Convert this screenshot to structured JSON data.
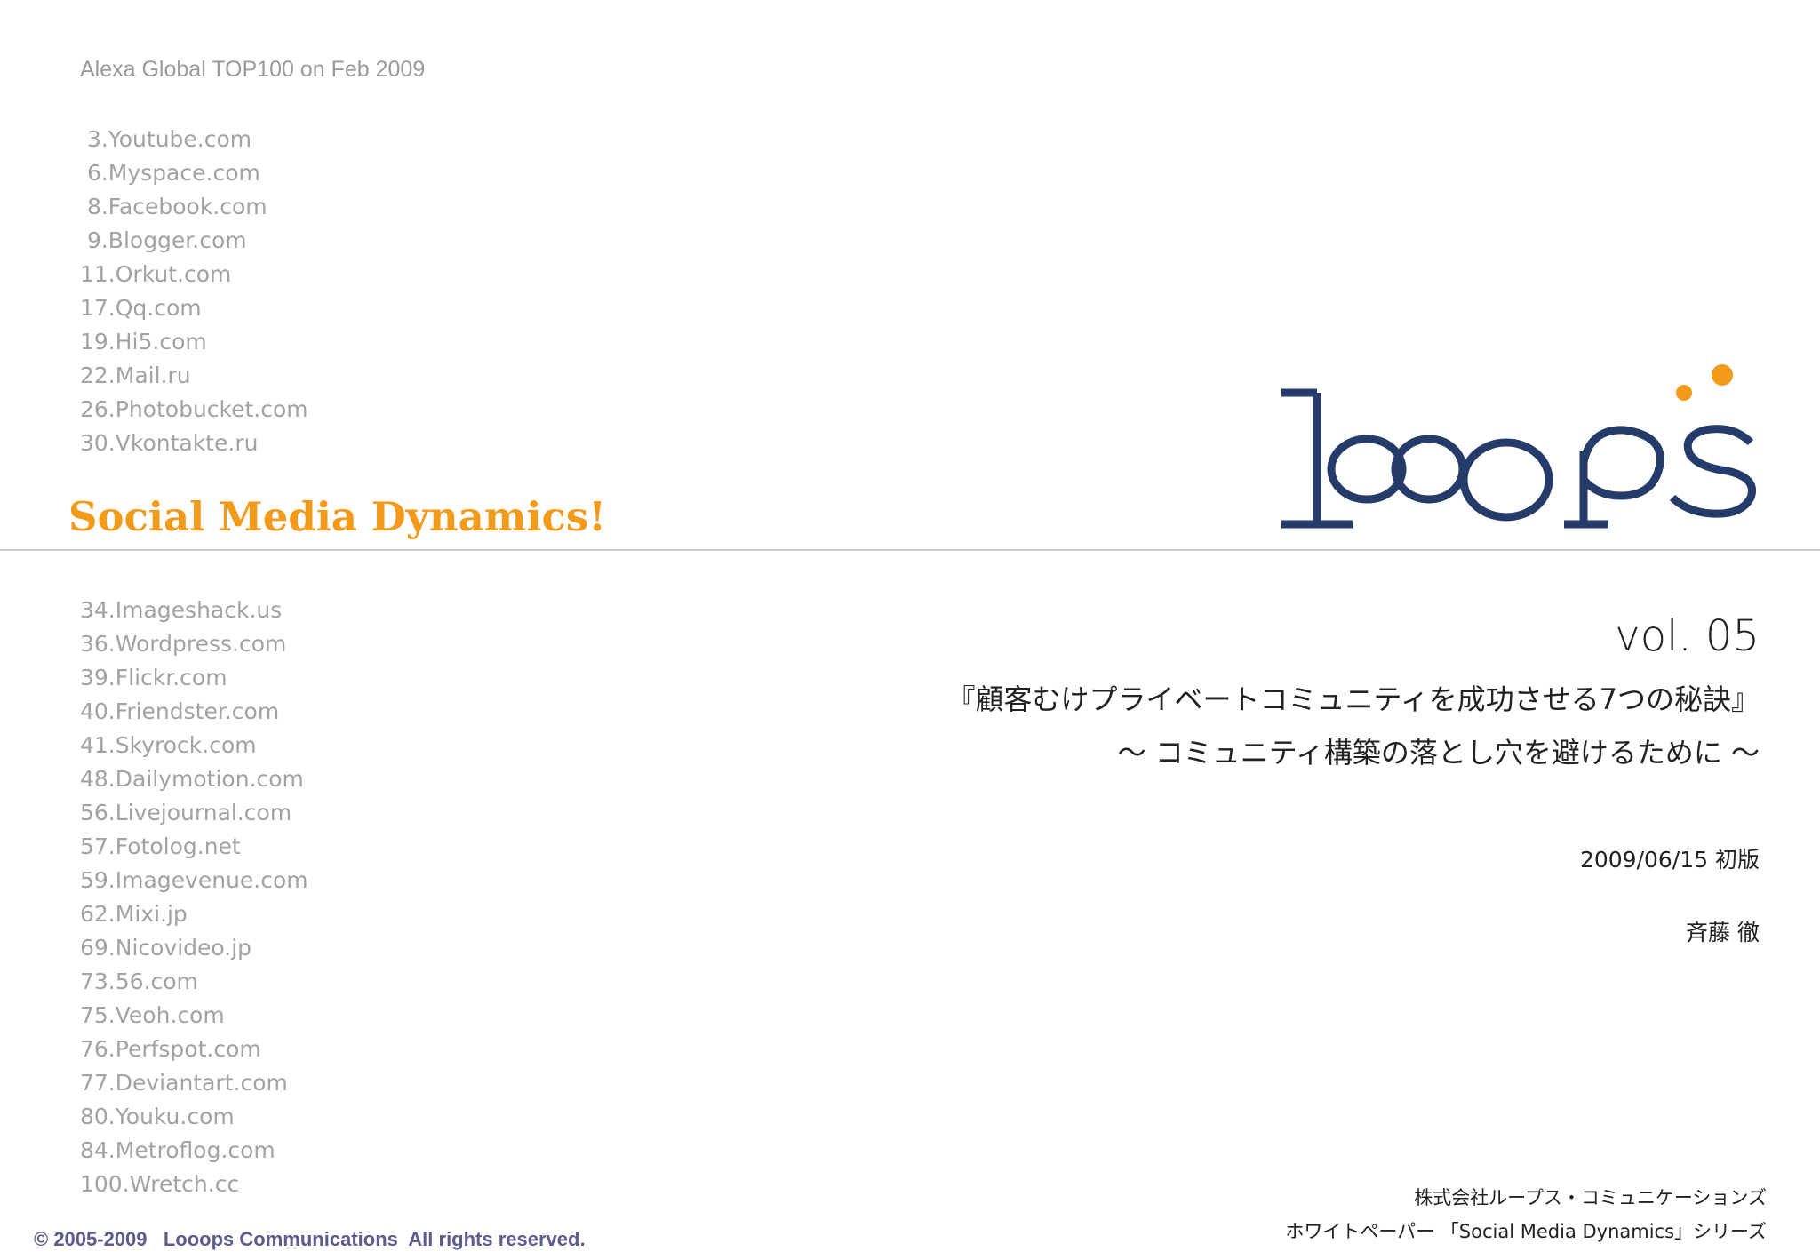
{
  "left_panel": {
    "list_header": "Alexa Global TOP100 on Feb 2009",
    "sites_top": [
      " 3.Youtube.com",
      " 6.Myspace.com",
      " 8.Facebook.com",
      " 9.Blogger.com",
      "11.Orkut.com",
      "17.Qq.com",
      "19.Hi5.com",
      "22.Mail.ru",
      "26.Photobucket.com",
      "30.Vkontakte.ru"
    ],
    "tagline": "Social Media Dynamics!",
    "sites_bottom": [
      "34.Imageshack.us",
      "36.Wordpress.com",
      "39.Flickr.com",
      "40.Friendster.com",
      "41.Skyrock.com",
      "48.Dailymotion.com",
      "56.Livejournal.com",
      "57.Fotolog.net",
      "59.Imagevenue.com",
      "62.Mixi.jp",
      "69.Nicovideo.jp",
      "73.56.com",
      "75.Veoh.com",
      "76.Perfspot.com",
      "77.Deviantart.com",
      "80.Youku.com",
      "84.Metroflog.com",
      "100.Wretch.cc"
    ]
  },
  "logo": {
    "description_icon": "looops-logo",
    "colors": {
      "navy": "#253c6b",
      "orange": "#f29a1a"
    }
  },
  "document": {
    "volume": "vol. 05",
    "title": "『顧客むけプライベートコミュニティを成功させる7つの秘訣』",
    "subtitle": "～ コミュニティ構築の落とし穴を避けるために ～",
    "date": "2009/06/15  初版",
    "author": "斉藤  徹"
  },
  "footer": {
    "copyright": "© 2005-2009   Looops Communications  All rights reserved.",
    "company": "株式会社ループス・コミュニケーションズ",
    "series": "ホワイトペーパー 「Social Media Dynamics」シリーズ"
  },
  "colors": {
    "accent_orange": "#f29a1a",
    "list_gray": "#a2a2a2",
    "divider_gray": "#c9c9c9",
    "copyright_blue": "#5c5c8e"
  }
}
